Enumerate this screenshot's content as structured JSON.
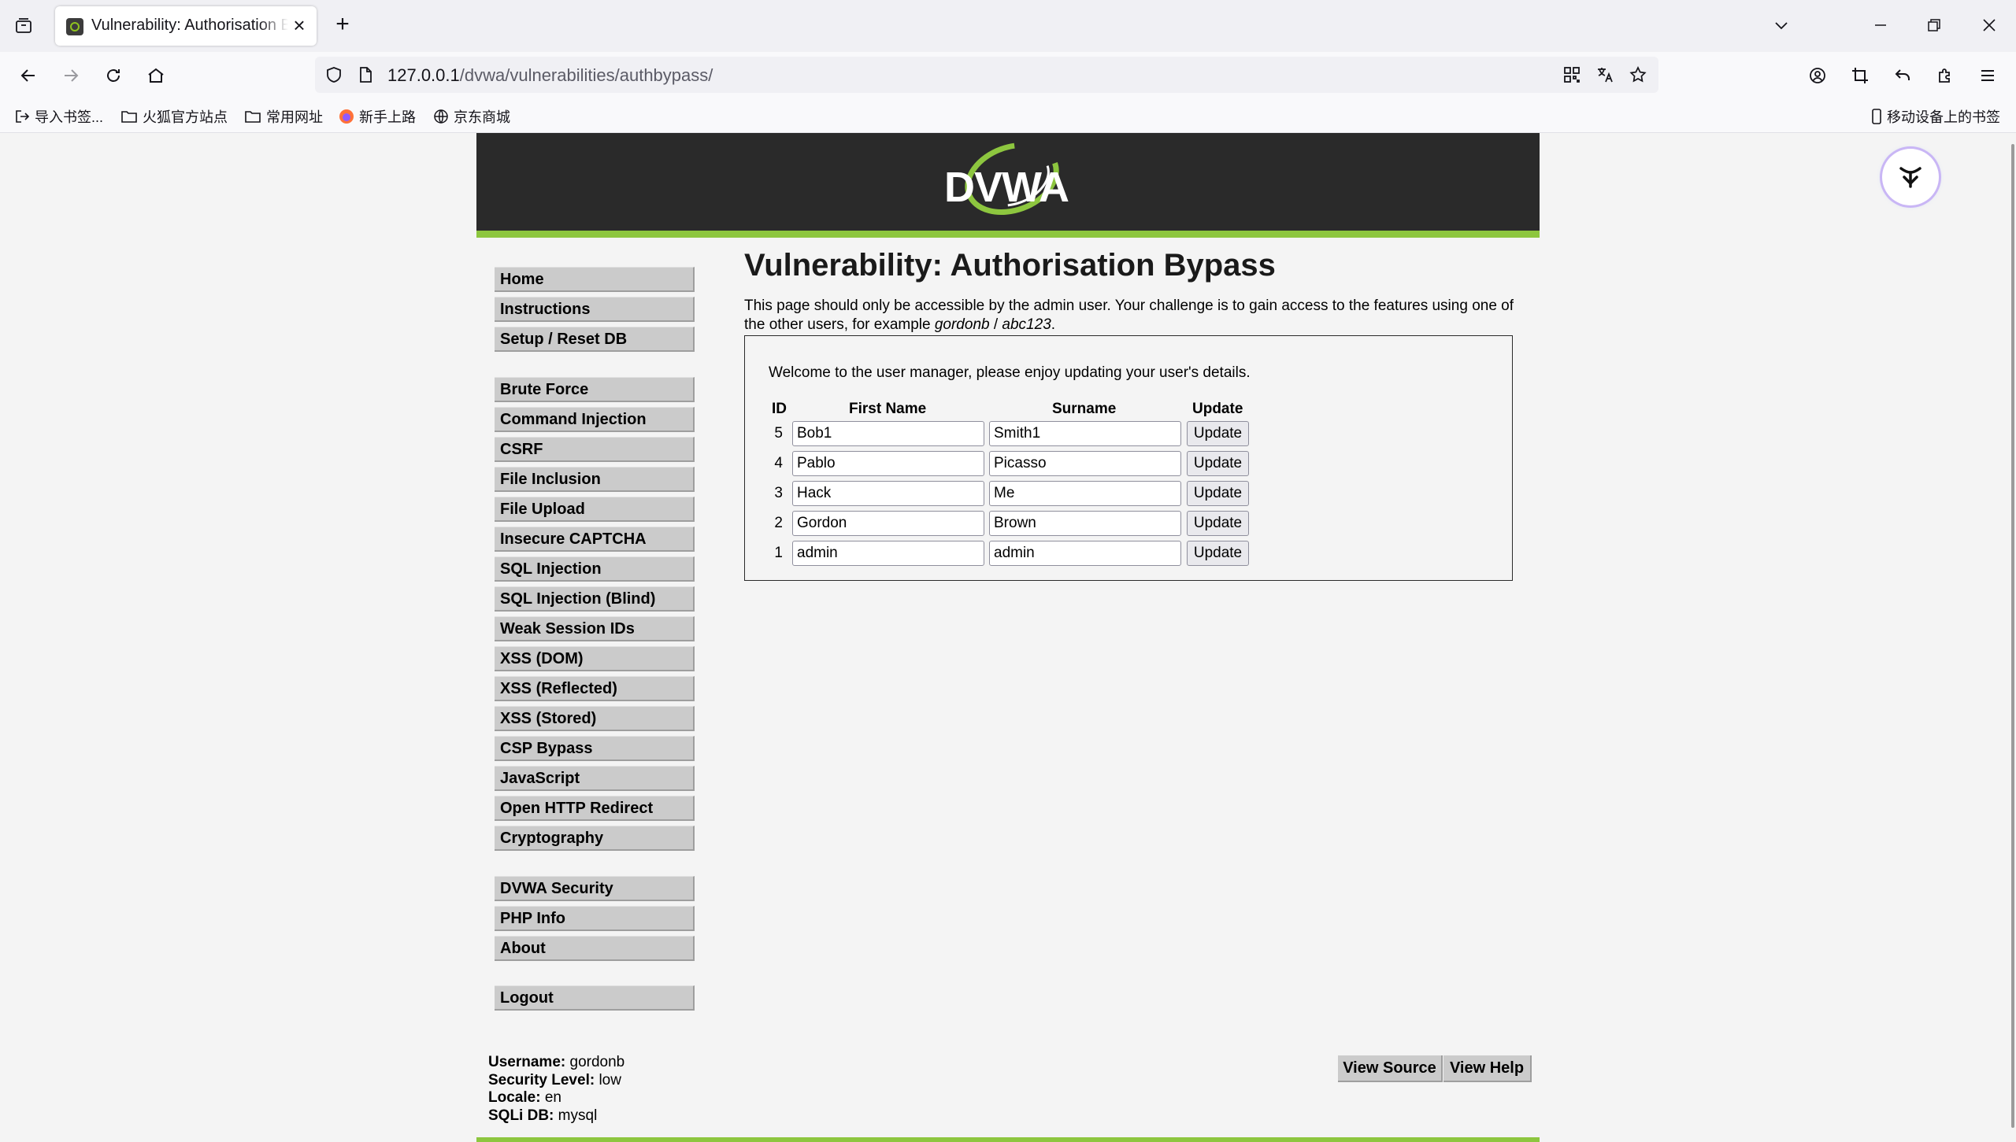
{
  "browser": {
    "tab_title": "Vulnerability: Authorisation Bypass :: Damn Vulnerable Web Application (DVWA)",
    "url_host": "127.0.0.1",
    "url_path": "/dvwa/vulnerabilities/authbypass/",
    "bookmarks": [
      {
        "label": "导入书签...",
        "icon": "import-icon"
      },
      {
        "label": "火狐官方站点",
        "icon": "folder-icon"
      },
      {
        "label": "常用网址",
        "icon": "folder-icon"
      },
      {
        "label": "新手上路",
        "icon": "firefox-icon"
      },
      {
        "label": "京东商城",
        "icon": "globe-icon"
      }
    ],
    "mobile_bookmarks": "移动设备上的书签"
  },
  "header": {
    "logo_text": "DVWA"
  },
  "menu": {
    "group1": [
      "Home",
      "Instructions",
      "Setup / Reset DB"
    ],
    "group2": [
      "Brute Force",
      "Command Injection",
      "CSRF",
      "File Inclusion",
      "File Upload",
      "Insecure CAPTCHA",
      "SQL Injection",
      "SQL Injection (Blind)",
      "Weak Session IDs",
      "XSS (DOM)",
      "XSS (Reflected)",
      "XSS (Stored)",
      "CSP Bypass",
      "JavaScript",
      "Open HTTP Redirect",
      "Cryptography"
    ],
    "group3": [
      "DVWA Security",
      "PHP Info",
      "About"
    ],
    "group4": [
      "Logout"
    ]
  },
  "main": {
    "title": "Vulnerability: Authorisation Bypass",
    "intro_1": "This page should only be accessible by the admin user. Your challenge is to gain access to the features using one of the other users, for example ",
    "intro_user": "gordonb",
    "intro_sep": " / ",
    "intro_pass": "abc123",
    "intro_end": ".",
    "welcome": "Welcome to the user manager, please enjoy updating your user's details.",
    "columns": {
      "id": "ID",
      "first": "First Name",
      "surname": "Surname",
      "update": "Update"
    },
    "users": [
      {
        "id": "5",
        "first": "Bob1",
        "surname": "Smith1"
      },
      {
        "id": "4",
        "first": "Pablo",
        "surname": "Picasso"
      },
      {
        "id": "3",
        "first": "Hack",
        "surname": "Me"
      },
      {
        "id": "2",
        "first": "Gordon",
        "surname": "Brown"
      },
      {
        "id": "1",
        "first": "admin",
        "surname": "admin"
      }
    ],
    "update_label": "Update"
  },
  "footer": {
    "username_label": "Username:",
    "username": "gordonb",
    "security_label": "Security Level:",
    "security": "low",
    "locale_label": "Locale:",
    "locale": "en",
    "sqli_label": "SQLi DB:",
    "sqli": "mysql",
    "view_source": "View Source",
    "view_help": "View Help"
  },
  "colors": {
    "accent": "#8dc63f",
    "header_bg": "#2a2a2a",
    "menu_bg": "#cbcbcb"
  }
}
